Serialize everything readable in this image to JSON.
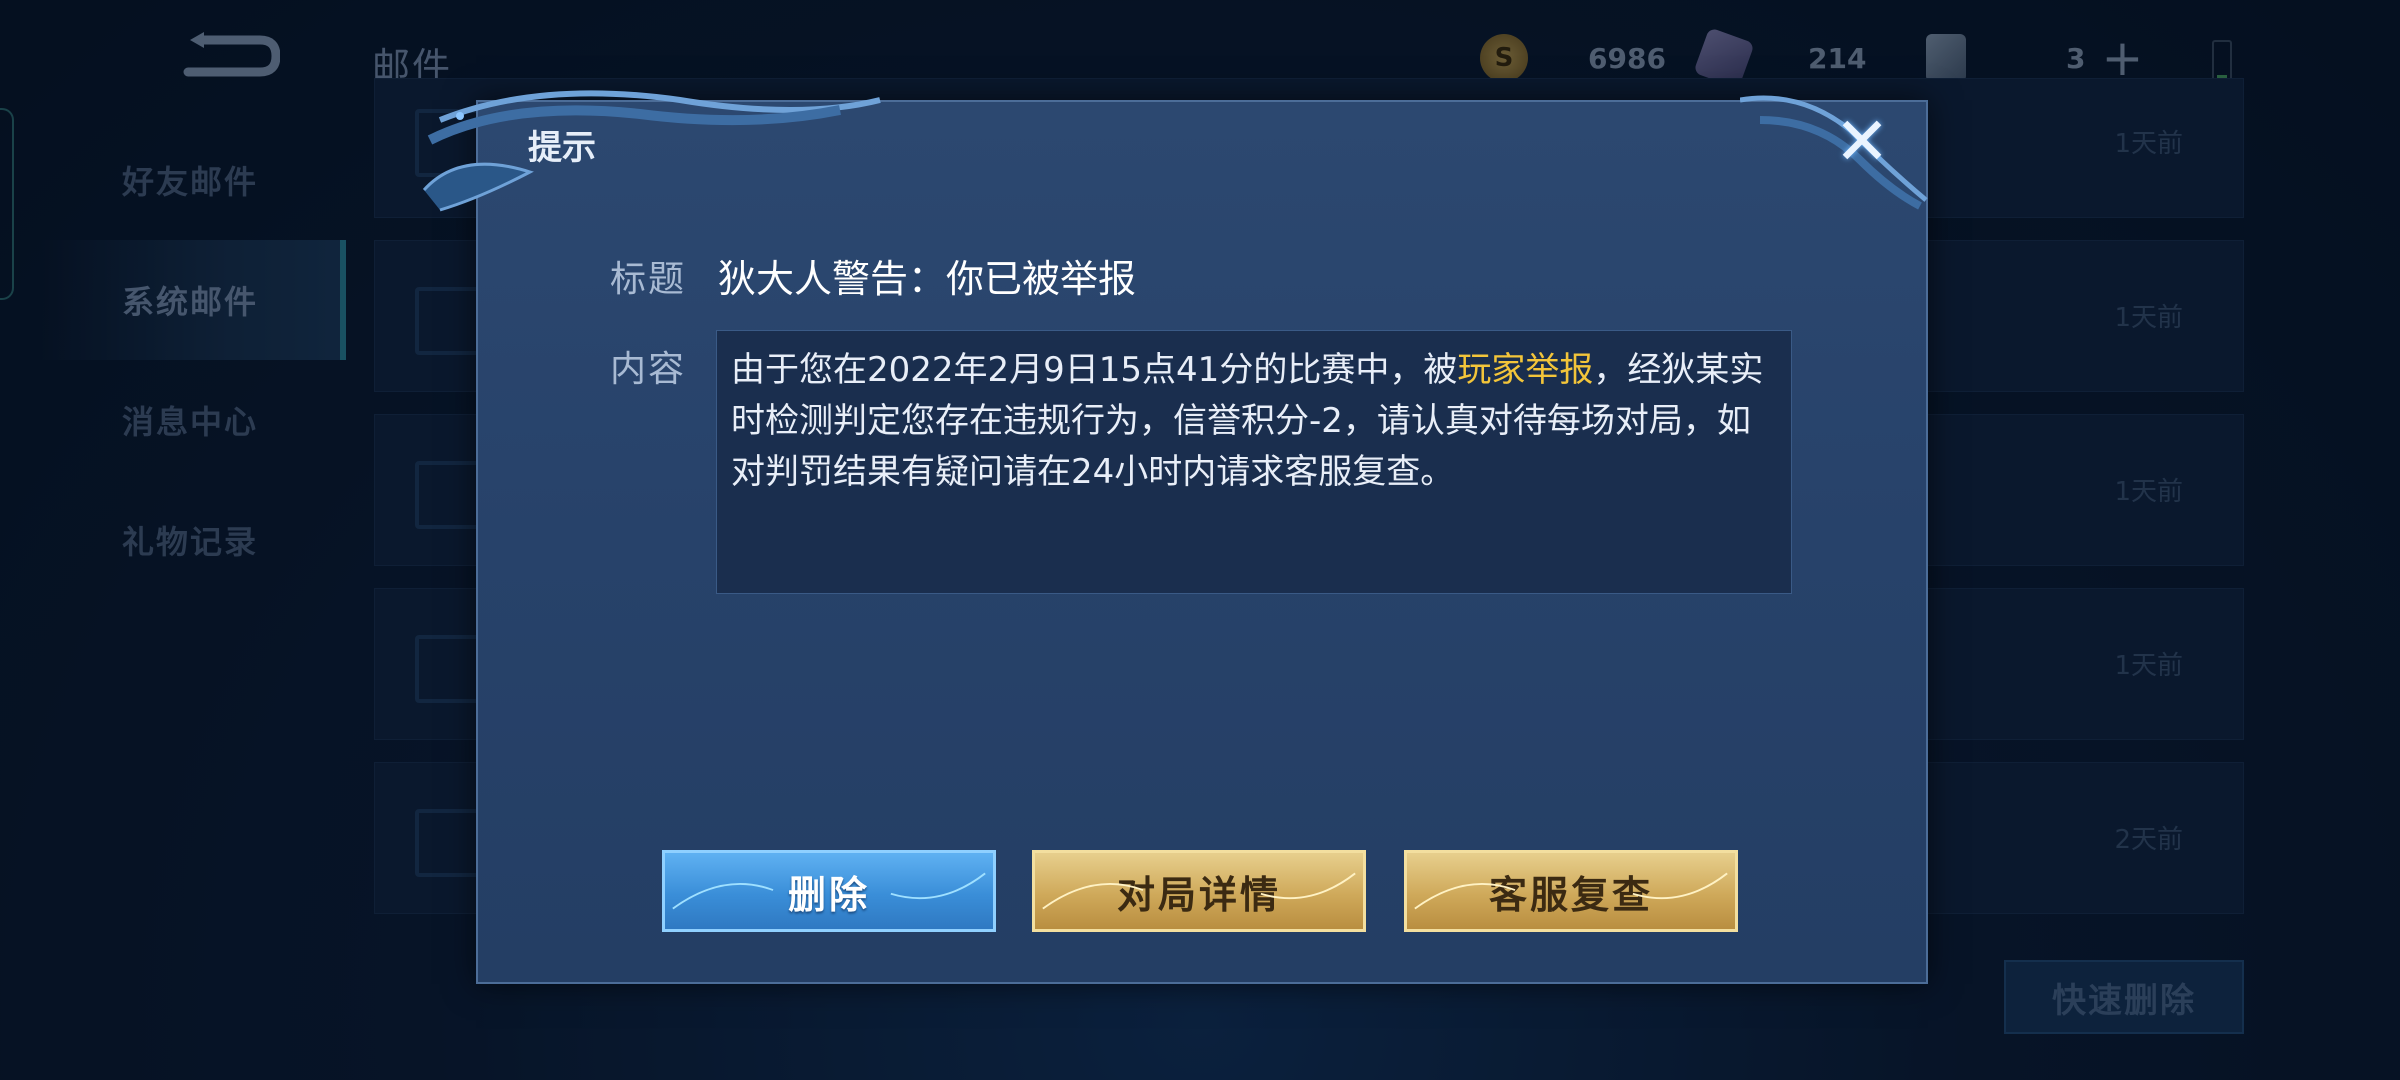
{
  "header": {
    "title": "邮件",
    "gold_value": "6986",
    "gem_value": "214",
    "ticket_value": "3"
  },
  "sidebar": {
    "items": [
      {
        "label": "好友邮件",
        "active": false
      },
      {
        "label": "系统邮件",
        "active": true
      },
      {
        "label": "消息中心",
        "active": false
      },
      {
        "label": "礼物记录",
        "active": false
      }
    ]
  },
  "mail_list": {
    "rows": [
      {
        "time": "1天前"
      },
      {
        "time": "1天前"
      },
      {
        "time": "1天前"
      },
      {
        "time": "1天前"
      },
      {
        "time": "2天前"
      }
    ],
    "quick_delete_label": "快速删除"
  },
  "dialog": {
    "title": "提示",
    "subject_label": "标题",
    "subject": "狄大人警告：你已被举报",
    "content_label": "内容",
    "content_before": "由于您在2022年2月9日15点41分的比赛中，被",
    "content_highlight": "玩家举报",
    "content_after": "，经狄某实时检测判定您存在违规行为，信誉积分-2，请认真对待每场对局，如对判罚结果有疑问请在24小时内请求客服复查。",
    "buttons": {
      "delete": "删除",
      "match_details": "对局详情",
      "support_review": "客服复查"
    }
  },
  "colors": {
    "highlight": "#f3c53a",
    "primary_button": "#3a8ed8",
    "gold_button": "#cfa95a",
    "dialog_bg": "#2a4570"
  }
}
